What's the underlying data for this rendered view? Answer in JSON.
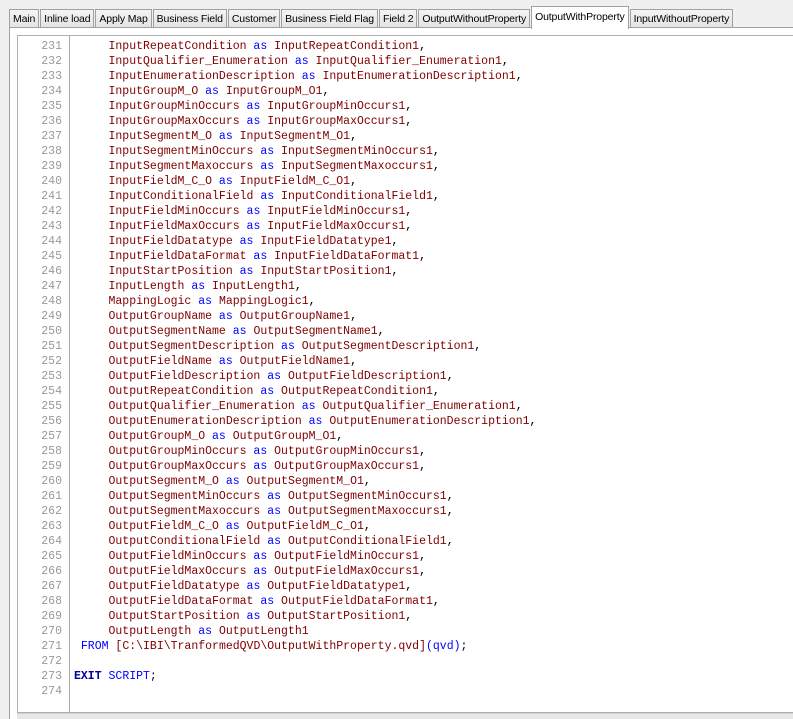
{
  "tabs": [
    "Main",
    "Inline load",
    "Apply Map",
    "Business Field",
    "Customer",
    "Business Field Flag",
    "Field 2",
    "OutputWithoutProperty",
    "OutputWithProperty",
    "InputWithoutProperty"
  ],
  "active_tab": "OutputWithProperty",
  "colors": {
    "field": "#800000",
    "keyword": "#0000ff",
    "line_number": "#999999"
  },
  "editor": {
    "lines": [
      {
        "num": "231",
        "parts": [
          [
            "f",
            "     InputRepeatCondition"
          ],
          [
            "k",
            " as "
          ],
          [
            "f",
            "InputRepeatCondition1"
          ],
          [
            "p",
            ","
          ]
        ]
      },
      {
        "num": "232",
        "parts": [
          [
            "f",
            "     InputQualifier_Enumeration"
          ],
          [
            "k",
            " as "
          ],
          [
            "f",
            "InputQualifier_Enumeration1"
          ],
          [
            "p",
            ","
          ]
        ]
      },
      {
        "num": "233",
        "parts": [
          [
            "f",
            "     InputEnumerationDescription"
          ],
          [
            "k",
            " as "
          ],
          [
            "f",
            "InputEnumerationDescription1"
          ],
          [
            "p",
            ","
          ]
        ]
      },
      {
        "num": "234",
        "parts": [
          [
            "f",
            "     InputGroupM_O"
          ],
          [
            "k",
            " as "
          ],
          [
            "f",
            "InputGroupM_O1"
          ],
          [
            "p",
            ","
          ]
        ]
      },
      {
        "num": "235",
        "parts": [
          [
            "f",
            "     InputGroupMinOccurs"
          ],
          [
            "k",
            " as "
          ],
          [
            "f",
            "InputGroupMinOccurs1"
          ],
          [
            "p",
            ","
          ]
        ]
      },
      {
        "num": "236",
        "parts": [
          [
            "f",
            "     InputGroupMaxOccurs"
          ],
          [
            "k",
            " as "
          ],
          [
            "f",
            "InputGroupMaxOccurs1"
          ],
          [
            "p",
            ","
          ]
        ]
      },
      {
        "num": "237",
        "parts": [
          [
            "f",
            "     InputSegmentM_O"
          ],
          [
            "k",
            " as "
          ],
          [
            "f",
            "InputSegmentM_O1"
          ],
          [
            "p",
            ","
          ]
        ]
      },
      {
        "num": "238",
        "parts": [
          [
            "f",
            "     InputSegmentMinOccurs"
          ],
          [
            "k",
            " as "
          ],
          [
            "f",
            "InputSegmentMinOccurs1"
          ],
          [
            "p",
            ","
          ]
        ]
      },
      {
        "num": "239",
        "parts": [
          [
            "f",
            "     InputSegmentMaxoccurs"
          ],
          [
            "k",
            " as "
          ],
          [
            "f",
            "InputSegmentMaxoccurs1"
          ],
          [
            "p",
            ","
          ]
        ]
      },
      {
        "num": "240",
        "parts": [
          [
            "f",
            "     InputFieldM_C_O"
          ],
          [
            "k",
            " as "
          ],
          [
            "f",
            "InputFieldM_C_O1"
          ],
          [
            "p",
            ","
          ]
        ]
      },
      {
        "num": "241",
        "parts": [
          [
            "f",
            "     InputConditionalField"
          ],
          [
            "k",
            " as "
          ],
          [
            "f",
            "InputConditionalField1"
          ],
          [
            "p",
            ","
          ]
        ]
      },
      {
        "num": "242",
        "parts": [
          [
            "f",
            "     InputFieldMinOccurs"
          ],
          [
            "k",
            " as "
          ],
          [
            "f",
            "InputFieldMinOccurs1"
          ],
          [
            "p",
            ","
          ]
        ]
      },
      {
        "num": "243",
        "parts": [
          [
            "f",
            "     InputFieldMaxOccurs"
          ],
          [
            "k",
            " as "
          ],
          [
            "f",
            "InputFieldMaxOccurs1"
          ],
          [
            "p",
            ","
          ]
        ]
      },
      {
        "num": "244",
        "parts": [
          [
            "f",
            "     InputFieldDatatype"
          ],
          [
            "k",
            " as "
          ],
          [
            "f",
            "InputFieldDatatype1"
          ],
          [
            "p",
            ","
          ]
        ]
      },
      {
        "num": "245",
        "parts": [
          [
            "f",
            "     InputFieldDataFormat"
          ],
          [
            "k",
            " as "
          ],
          [
            "f",
            "InputFieldDataFormat1"
          ],
          [
            "p",
            ","
          ]
        ]
      },
      {
        "num": "246",
        "parts": [
          [
            "f",
            "     InputStartPosition"
          ],
          [
            "k",
            " as "
          ],
          [
            "f",
            "InputStartPosition1"
          ],
          [
            "p",
            ","
          ]
        ]
      },
      {
        "num": "247",
        "parts": [
          [
            "f",
            "     InputLength"
          ],
          [
            "k",
            " as "
          ],
          [
            "f",
            "InputLength1"
          ],
          [
            "p",
            ","
          ]
        ]
      },
      {
        "num": "248",
        "parts": [
          [
            "f",
            "     MappingLogic"
          ],
          [
            "k",
            " as "
          ],
          [
            "f",
            "MappingLogic1"
          ],
          [
            "p",
            ","
          ]
        ]
      },
      {
        "num": "249",
        "parts": [
          [
            "f",
            "     OutputGroupName"
          ],
          [
            "k",
            " as "
          ],
          [
            "f",
            "OutputGroupName1"
          ],
          [
            "p",
            ","
          ]
        ]
      },
      {
        "num": "250",
        "parts": [
          [
            "f",
            "     OutputSegmentName"
          ],
          [
            "k",
            " as "
          ],
          [
            "f",
            "OutputSegmentName1"
          ],
          [
            "p",
            ","
          ]
        ]
      },
      {
        "num": "251",
        "parts": [
          [
            "f",
            "     OutputSegmentDescription"
          ],
          [
            "k",
            " as "
          ],
          [
            "f",
            "OutputSegmentDescription1"
          ],
          [
            "p",
            ","
          ]
        ]
      },
      {
        "num": "252",
        "parts": [
          [
            "f",
            "     OutputFieldName"
          ],
          [
            "k",
            " as "
          ],
          [
            "f",
            "OutputFieldName1"
          ],
          [
            "p",
            ","
          ]
        ]
      },
      {
        "num": "253",
        "parts": [
          [
            "f",
            "     OutputFieldDescription"
          ],
          [
            "k",
            " as "
          ],
          [
            "f",
            "OutputFieldDescription1"
          ],
          [
            "p",
            ","
          ]
        ]
      },
      {
        "num": "254",
        "parts": [
          [
            "f",
            "     OutputRepeatCondition"
          ],
          [
            "k",
            " as "
          ],
          [
            "f",
            "OutputRepeatCondition1"
          ],
          [
            "p",
            ","
          ]
        ]
      },
      {
        "num": "255",
        "parts": [
          [
            "f",
            "     OutputQualifier_Enumeration"
          ],
          [
            "k",
            " as "
          ],
          [
            "f",
            "OutputQualifier_Enumeration1"
          ],
          [
            "p",
            ","
          ]
        ]
      },
      {
        "num": "256",
        "parts": [
          [
            "f",
            "     OutputEnumerationDescription"
          ],
          [
            "k",
            " as "
          ],
          [
            "f",
            "OutputEnumerationDescription1"
          ],
          [
            "p",
            ","
          ]
        ]
      },
      {
        "num": "257",
        "parts": [
          [
            "f",
            "     OutputGroupM_O"
          ],
          [
            "k",
            " as "
          ],
          [
            "f",
            "OutputGroupM_O1"
          ],
          [
            "p",
            ","
          ]
        ]
      },
      {
        "num": "258",
        "parts": [
          [
            "f",
            "     OutputGroupMinOccurs"
          ],
          [
            "k",
            " as "
          ],
          [
            "f",
            "OutputGroupMinOccurs1"
          ],
          [
            "p",
            ","
          ]
        ]
      },
      {
        "num": "259",
        "parts": [
          [
            "f",
            "     OutputGroupMaxOccurs"
          ],
          [
            "k",
            " as "
          ],
          [
            "f",
            "OutputGroupMaxOccurs1"
          ],
          [
            "p",
            ","
          ]
        ]
      },
      {
        "num": "260",
        "parts": [
          [
            "f",
            "     OutputSegmentM_O"
          ],
          [
            "k",
            " as "
          ],
          [
            "f",
            "OutputSegmentM_O1"
          ],
          [
            "p",
            ","
          ]
        ]
      },
      {
        "num": "261",
        "parts": [
          [
            "f",
            "     OutputSegmentMinOccurs"
          ],
          [
            "k",
            " as "
          ],
          [
            "f",
            "OutputSegmentMinOccurs1"
          ],
          [
            "p",
            ","
          ]
        ]
      },
      {
        "num": "262",
        "parts": [
          [
            "f",
            "     OutputSegmentMaxoccurs"
          ],
          [
            "k",
            " as "
          ],
          [
            "f",
            "OutputSegmentMaxoccurs1"
          ],
          [
            "p",
            ","
          ]
        ]
      },
      {
        "num": "263",
        "parts": [
          [
            "f",
            "     OutputFieldM_C_O"
          ],
          [
            "k",
            " as "
          ],
          [
            "f",
            "OutputFieldM_C_O1"
          ],
          [
            "p",
            ","
          ]
        ]
      },
      {
        "num": "264",
        "parts": [
          [
            "f",
            "     OutputConditionalField"
          ],
          [
            "k",
            " as "
          ],
          [
            "f",
            "OutputConditionalField1"
          ],
          [
            "p",
            ","
          ]
        ]
      },
      {
        "num": "265",
        "parts": [
          [
            "f",
            "     OutputFieldMinOccurs"
          ],
          [
            "k",
            " as "
          ],
          [
            "f",
            "OutputFieldMinOccurs1"
          ],
          [
            "p",
            ","
          ]
        ]
      },
      {
        "num": "266",
        "parts": [
          [
            "f",
            "     OutputFieldMaxOccurs"
          ],
          [
            "k",
            " as "
          ],
          [
            "f",
            "OutputFieldMaxOccurs1"
          ],
          [
            "p",
            ","
          ]
        ]
      },
      {
        "num": "267",
        "parts": [
          [
            "f",
            "     OutputFieldDatatype"
          ],
          [
            "k",
            " as "
          ],
          [
            "f",
            "OutputFieldDatatype1"
          ],
          [
            "p",
            ","
          ]
        ]
      },
      {
        "num": "268",
        "parts": [
          [
            "f",
            "     OutputFieldDataFormat"
          ],
          [
            "k",
            " as "
          ],
          [
            "f",
            "OutputFieldDataFormat1"
          ],
          [
            "p",
            ","
          ]
        ]
      },
      {
        "num": "269",
        "parts": [
          [
            "f",
            "     OutputStartPosition"
          ],
          [
            "k",
            " as "
          ],
          [
            "f",
            "OutputStartPosition1"
          ],
          [
            "p",
            ","
          ]
        ]
      },
      {
        "num": "270",
        "parts": [
          [
            "f",
            "     OutputLength"
          ],
          [
            "k",
            " as "
          ],
          [
            "f",
            "OutputLength1"
          ]
        ]
      },
      {
        "num": "271",
        "parts": [
          [
            "k",
            " FROM "
          ],
          [
            "f",
            "[C:\\IBI\\TranformedQVD\\OutputWithProperty.qvd]"
          ],
          [
            "k",
            "(qvd)"
          ],
          [
            "p",
            ";"
          ]
        ]
      },
      {
        "num": "272",
        "parts": []
      },
      {
        "num": "273",
        "parts": [
          [
            "kb",
            "EXIT"
          ],
          [
            "k",
            " SCRIPT"
          ],
          [
            "p",
            ";"
          ]
        ]
      },
      {
        "num": "274",
        "parts": []
      }
    ]
  }
}
